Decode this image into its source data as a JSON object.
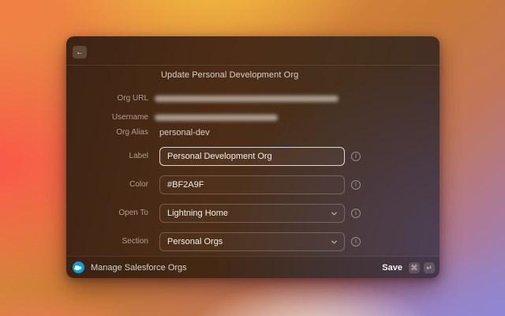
{
  "window": {
    "title": "Update Personal Development Org"
  },
  "form": {
    "org_url": {
      "label": "Org URL",
      "value_redacted": true
    },
    "username": {
      "label": "Username",
      "value_redacted": true
    },
    "org_alias": {
      "label": "Org Alias",
      "value": "personal-dev"
    },
    "label_field": {
      "label": "Label",
      "value": "Personal Development Org"
    },
    "color_field": {
      "label": "Color",
      "value": "#BF2A9F"
    },
    "open_to": {
      "label": "Open To",
      "value": "Lightning Home"
    },
    "section": {
      "label": "Section",
      "value": "Personal Orgs"
    }
  },
  "footer": {
    "app_name": "Manage Salesforce Orgs",
    "save_label": "Save",
    "keys": {
      "cmd": "⌘",
      "enter": "↵"
    }
  },
  "icons": {
    "back": "←",
    "info": "i"
  },
  "colors": {
    "salesforce_blue": "#0b9dd9",
    "color_field_value": "#BF2A9F"
  }
}
